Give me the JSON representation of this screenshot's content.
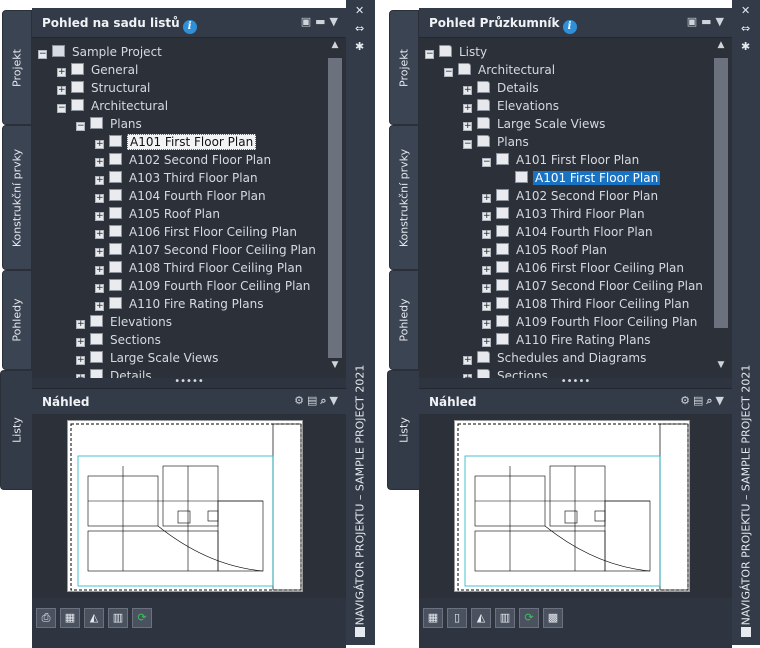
{
  "left": {
    "tabs": [
      "Projekt",
      "Konstrukční prvky",
      "Pohledy",
      "Listy"
    ],
    "header_title": "Pohled na sadu listů",
    "tree": [
      {
        "level": 0,
        "pm": "-",
        "icon": "project",
        "label": "Sample Project"
      },
      {
        "level": 1,
        "pm": "+",
        "icon": "sheet",
        "label": "General"
      },
      {
        "level": 1,
        "pm": "+",
        "icon": "sheet",
        "label": "Structural"
      },
      {
        "level": 1,
        "pm": "-",
        "icon": "sheet",
        "label": "Architectural"
      },
      {
        "level": 2,
        "pm": "-",
        "icon": "sheet",
        "label": "Plans"
      },
      {
        "level": 3,
        "pm": "+",
        "icon": "sheet",
        "label": "A101 First Floor Plan",
        "state": "sel"
      },
      {
        "level": 3,
        "pm": "+",
        "icon": "sheet",
        "label": "A102 Second Floor Plan"
      },
      {
        "level": 3,
        "pm": "+",
        "icon": "sheet",
        "label": "A103 Third Floor Plan"
      },
      {
        "level": 3,
        "pm": "+",
        "icon": "sheet",
        "label": "A104 Fourth Floor Plan"
      },
      {
        "level": 3,
        "pm": "+",
        "icon": "sheet",
        "label": "A105 Roof Plan"
      },
      {
        "level": 3,
        "pm": "+",
        "icon": "sheet",
        "label": "A106 First Floor Ceiling Plan"
      },
      {
        "level": 3,
        "pm": "+",
        "icon": "sheet",
        "label": "A107 Second Floor Ceiling Plan"
      },
      {
        "level": 3,
        "pm": "+",
        "icon": "sheet",
        "label": "A108 Third Floor Ceiling Plan"
      },
      {
        "level": 3,
        "pm": "+",
        "icon": "sheet",
        "label": "A109 Fourth Floor Ceiling Plan"
      },
      {
        "level": 3,
        "pm": "+",
        "icon": "sheet",
        "label": "A110 Fire Rating Plans"
      },
      {
        "level": 2,
        "pm": "+",
        "icon": "sheet",
        "label": "Elevations"
      },
      {
        "level": 2,
        "pm": "+",
        "icon": "sheet",
        "label": "Sections"
      },
      {
        "level": 2,
        "pm": "+",
        "icon": "sheet",
        "label": "Large Scale Views"
      },
      {
        "level": 2,
        "pm": "+",
        "icon": "sheet",
        "label": "Details"
      }
    ],
    "preview_title": "Náhled",
    "vertical_title": "NAVIGÁTOR PROJEKTU – SAMPLE PROJECT 2021"
  },
  "right": {
    "tabs": [
      "Projekt",
      "Konstrukční prvky",
      "Pohledy",
      "Listy"
    ],
    "header_title": "Pohled Průzkumník",
    "tree": [
      {
        "level": 0,
        "pm": "-",
        "icon": "folder",
        "label": "Listy"
      },
      {
        "level": 1,
        "pm": "-",
        "icon": "folder",
        "label": "Architectural"
      },
      {
        "level": 2,
        "pm": "+",
        "icon": "folder",
        "label": "Details"
      },
      {
        "level": 2,
        "pm": "+",
        "icon": "folder",
        "label": "Elevations"
      },
      {
        "level": 2,
        "pm": "+",
        "icon": "folder",
        "label": "Large Scale Views"
      },
      {
        "level": 2,
        "pm": "-",
        "icon": "folder",
        "label": "Plans"
      },
      {
        "level": 3,
        "pm": "-",
        "icon": "sheet",
        "label": "A101 First Floor Plan"
      },
      {
        "level": 4,
        "pm": "",
        "icon": "sheet",
        "label": "A101 First Floor Plan",
        "state": "hi"
      },
      {
        "level": 3,
        "pm": "+",
        "icon": "sheet",
        "label": "A102 Second Floor Plan"
      },
      {
        "level": 3,
        "pm": "+",
        "icon": "sheet",
        "label": "A103 Third Floor Plan"
      },
      {
        "level": 3,
        "pm": "+",
        "icon": "sheet",
        "label": "A104 Fourth Floor Plan"
      },
      {
        "level": 3,
        "pm": "+",
        "icon": "sheet",
        "label": "A105 Roof Plan"
      },
      {
        "level": 3,
        "pm": "+",
        "icon": "sheet",
        "label": "A106 First Floor Ceiling Plan"
      },
      {
        "level": 3,
        "pm": "+",
        "icon": "sheet",
        "label": "A107 Second Floor Ceiling Plan"
      },
      {
        "level": 3,
        "pm": "+",
        "icon": "sheet",
        "label": "A108 Third Floor Ceiling Plan"
      },
      {
        "level": 3,
        "pm": "+",
        "icon": "sheet",
        "label": "A109 Fourth Floor Ceiling Plan"
      },
      {
        "level": 3,
        "pm": "+",
        "icon": "sheet",
        "label": "A110 Fire Rating Plans"
      },
      {
        "level": 2,
        "pm": "+",
        "icon": "folder",
        "label": "Schedules and Diagrams"
      },
      {
        "level": 2,
        "pm": "+",
        "icon": "folder",
        "label": "Sections"
      }
    ],
    "preview_title": "Náhled",
    "vertical_title": "NAVIGÁTOR PROJEKTU – SAMPLE PROJECT 2021"
  },
  "colors": {
    "selection_blue": "#1a72c2",
    "info_blue": "#2f8fd9",
    "green_refresh": "#3cc05a"
  }
}
